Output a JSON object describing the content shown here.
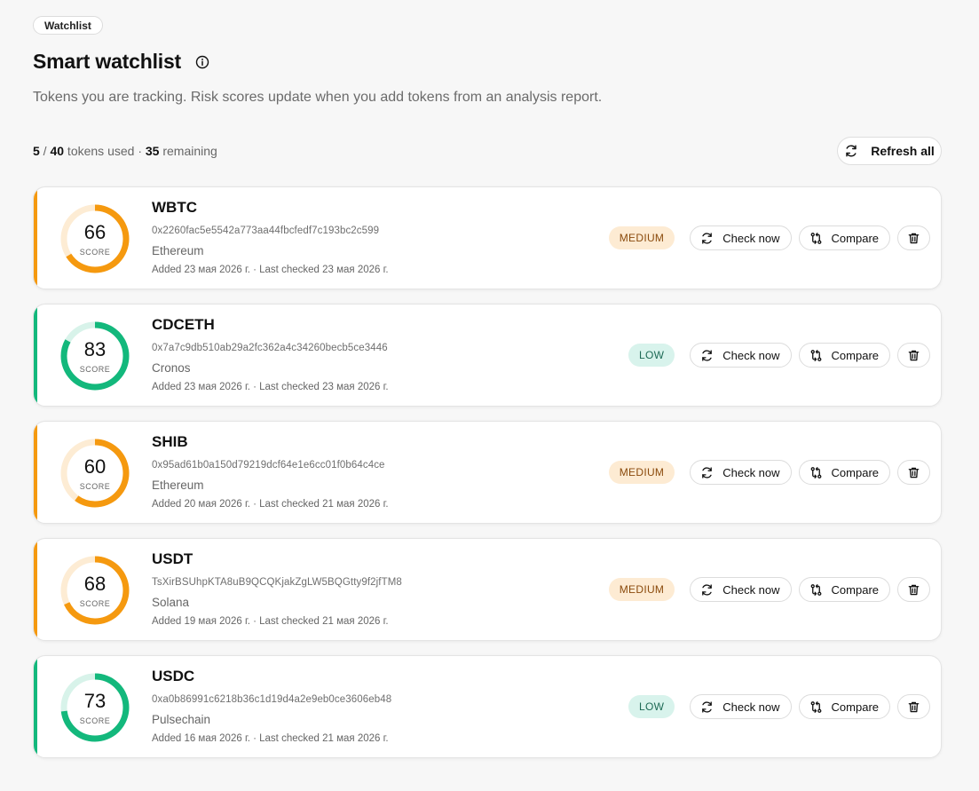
{
  "breadcrumb": "Watchlist",
  "page": {
    "title": "Smart watchlist",
    "subtitle": "Tokens you are tracking. Risk scores update when you add tokens from an analysis report."
  },
  "usage": {
    "used": "5",
    "separator": " / ",
    "limit": "40",
    "used_label": " tokens used · ",
    "remaining": "35",
    "remaining_label": " remaining"
  },
  "refresh_all_label": "Refresh all",
  "colors": {
    "medium": "#f5990f",
    "medium_track": "#fdecd4",
    "low": "#13b87c",
    "low_track": "#d8f3ea"
  },
  "labels": {
    "score": "SCORE",
    "check_now": "Check now",
    "compare": "Compare"
  },
  "icons": {
    "refresh": "refresh-icon",
    "compare": "compare-icon",
    "delete": "trash-icon",
    "info": "info-icon"
  },
  "tokens": [
    {
      "symbol": "WBTC",
      "address": "0x2260fac5e5542a773aa44fbcfedf7c193bc2c599",
      "chain": "Ethereum",
      "dates": "Added 23 мая 2026 г. · Last checked 23 мая 2026 г.",
      "score": 66,
      "risk": "MEDIUM",
      "level": "medium"
    },
    {
      "symbol": "CDCETH",
      "address": "0x7a7c9db510ab29a2fc362a4c34260becb5ce3446",
      "chain": "Cronos",
      "dates": "Added 23 мая 2026 г. · Last checked 23 мая 2026 г.",
      "score": 83,
      "risk": "LOW",
      "level": "low"
    },
    {
      "symbol": "SHIB",
      "address": "0x95ad61b0a150d79219dcf64e1e6cc01f0b64c4ce",
      "chain": "Ethereum",
      "dates": "Added 20 мая 2026 г. · Last checked 21 мая 2026 г.",
      "score": 60,
      "risk": "MEDIUM",
      "level": "medium"
    },
    {
      "symbol": "USDT",
      "address": "TsXirBSUhpKTA8uB9QCQKjakZgLW5BQGtty9f2jfTM8",
      "chain": "Solana",
      "dates": "Added 19 мая 2026 г. · Last checked 21 мая 2026 г.",
      "score": 68,
      "risk": "MEDIUM",
      "level": "medium"
    },
    {
      "symbol": "USDC",
      "address": "0xa0b86991c6218b36c1d19d4a2e9eb0ce3606eb48",
      "chain": "Pulsechain",
      "dates": "Added 16 мая 2026 г. · Last checked 21 мая 2026 г.",
      "score": 73,
      "risk": "LOW",
      "level": "low"
    }
  ]
}
